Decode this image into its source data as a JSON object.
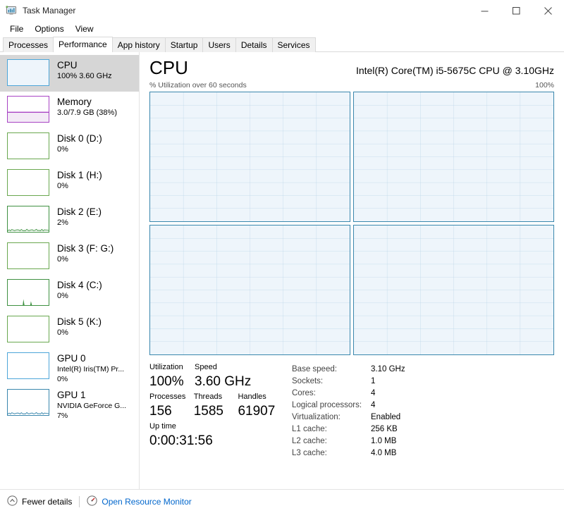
{
  "window": {
    "title": "Task Manager",
    "icon": "task-manager-icon",
    "minimize_label": "─",
    "maximize_label": "□",
    "close_label": "✕"
  },
  "menu": {
    "items": [
      {
        "label": "File"
      },
      {
        "label": "Options"
      },
      {
        "label": "View"
      }
    ]
  },
  "tabs": {
    "active": "Performance",
    "items": [
      {
        "label": "Processes"
      },
      {
        "label": "Performance"
      },
      {
        "label": "App history"
      },
      {
        "label": "Startup"
      },
      {
        "label": "Users"
      },
      {
        "label": "Details"
      },
      {
        "label": "Services"
      }
    ]
  },
  "sidebar": {
    "items": [
      {
        "name": "CPU",
        "sub": "100%  3.60 GHz",
        "sub2": "",
        "selected": true,
        "color": "#4da6d9",
        "fill": "#eef5fb",
        "trace": "flat-low"
      },
      {
        "name": "Memory",
        "sub": "3.0/7.9 GB (38%)",
        "sub2": "",
        "selected": false,
        "color": "#a843c4",
        "fill": "#f3eaf6",
        "trace": "memory-fill-38"
      },
      {
        "name": "Disk 0 (D:)",
        "sub": "0%",
        "sub2": "",
        "selected": false,
        "color": "#6aa84f",
        "fill": "#ffffff",
        "trace": "empty"
      },
      {
        "name": "Disk 1 (H:)",
        "sub": "0%",
        "sub2": "",
        "selected": false,
        "color": "#6aa84f",
        "fill": "#ffffff",
        "trace": "empty"
      },
      {
        "name": "Disk 2 (E:)",
        "sub": "2%",
        "sub2": "",
        "selected": false,
        "color": "#3f9142",
        "fill": "#ffffff",
        "trace": "low-noise"
      },
      {
        "name": "Disk 3 (F: G:)",
        "sub": "0%",
        "sub2": "",
        "selected": false,
        "color": "#6aa84f",
        "fill": "#ffffff",
        "trace": "empty"
      },
      {
        "name": "Disk 4 (C:)",
        "sub": "0%",
        "sub2": "",
        "selected": false,
        "color": "#3f9142",
        "fill": "#ffffff",
        "trace": "spikes"
      },
      {
        "name": "Disk 5 (K:)",
        "sub": "0%",
        "sub2": "",
        "selected": false,
        "color": "#6aa84f",
        "fill": "#ffffff",
        "trace": "empty"
      },
      {
        "name": "GPU 0",
        "sub": "Intel(R) Iris(TM) Pr...",
        "sub2": "0%",
        "selected": false,
        "color": "#4da6d9",
        "fill": "#ffffff",
        "trace": "empty"
      },
      {
        "name": "GPU 1",
        "sub": "NVIDIA GeForce G...",
        "sub2": "7%",
        "selected": false,
        "color": "#3a87ad",
        "fill": "#ffffff",
        "trace": "low-noise-blue"
      }
    ]
  },
  "detail": {
    "title": "CPU",
    "model": "Intel(R) Core(TM) i5-5675C CPU @ 3.10GHz",
    "axis_left": "% Utilization over 60 seconds",
    "axis_right": "100%",
    "graph_count": 4,
    "graph_border_color": "#3a87ad",
    "graph_fill_color": "#eef5fb",
    "grid_columns": 6,
    "grid_rows": 10,
    "stats": {
      "utilization_label": "Utilization",
      "utilization_value": "100%",
      "speed_label": "Speed",
      "speed_value": "3.60 GHz",
      "processes_label": "Processes",
      "processes_value": "156",
      "threads_label": "Threads",
      "threads_value": "1585",
      "handles_label": "Handles",
      "handles_value": "61907",
      "uptime_label": "Up time",
      "uptime_value": "0:00:31:56"
    },
    "specs": [
      {
        "label": "Base speed:",
        "value": "3.10 GHz"
      },
      {
        "label": "Sockets:",
        "value": "1"
      },
      {
        "label": "Cores:",
        "value": "4"
      },
      {
        "label": "Logical processors:",
        "value": "4"
      },
      {
        "label": "Virtualization:",
        "value": "Enabled"
      },
      {
        "label": "L1 cache:",
        "value": "256 KB"
      },
      {
        "label": "L2 cache:",
        "value": "1.0 MB"
      },
      {
        "label": "L3 cache:",
        "value": "4.0 MB"
      }
    ]
  },
  "footer": {
    "fewer_details_label": "Fewer details",
    "resource_monitor_label": "Open Resource Monitor",
    "link_color": "#0066cc"
  }
}
